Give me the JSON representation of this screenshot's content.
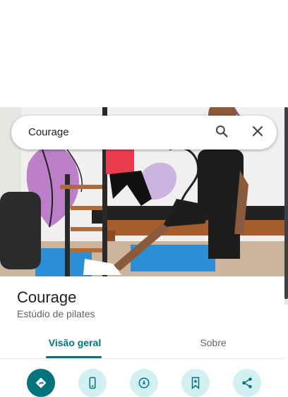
{
  "search": {
    "value": "Courage",
    "search_icon": "search-icon",
    "close_icon": "close-icon"
  },
  "place": {
    "name": "Courage",
    "category": "Estúdio de pilates",
    "photo": "pilates-studio-photo"
  },
  "tabs": [
    {
      "label": "Visão geral",
      "selected": true
    },
    {
      "label": "Sobre",
      "selected": false
    }
  ],
  "actions": [
    {
      "icon": "directions-icon"
    },
    {
      "icon": "phone-icon"
    },
    {
      "icon": "start-icon"
    },
    {
      "icon": "save-icon"
    },
    {
      "icon": "share-icon"
    }
  ],
  "colors": {
    "accent": "#01737a",
    "action_bg": "#d2eff2"
  }
}
